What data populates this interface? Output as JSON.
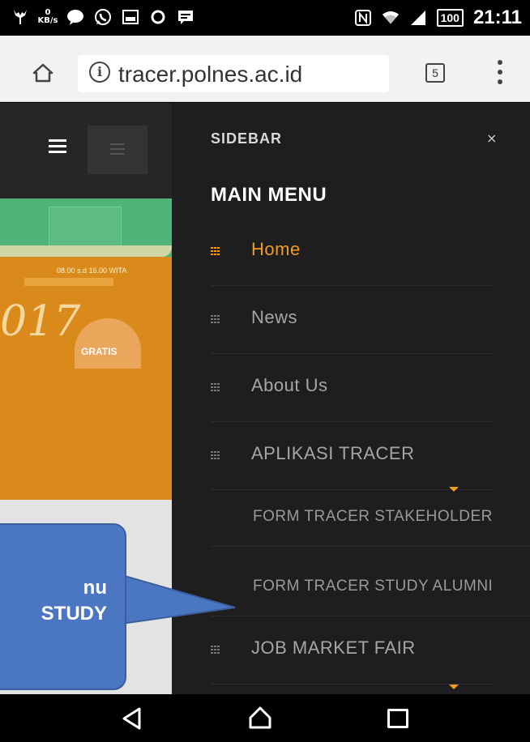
{
  "status_bar": {
    "speed_value": "0",
    "speed_unit": "KB/s",
    "battery": "100",
    "time": "21:11"
  },
  "browser": {
    "url": "tracer.polnes.ac.id",
    "tab_count": "5"
  },
  "banner": {
    "hours": "08.00 s.d 16.00 WITA",
    "year": "017",
    "gratis": "GRATIS"
  },
  "sidebar": {
    "title": "SIDEBAR",
    "close": "×",
    "main_menu": "MAIN MENU",
    "items": [
      {
        "label": "Home",
        "active": true
      },
      {
        "label": "News",
        "active": false
      },
      {
        "label": "About Us",
        "active": false
      },
      {
        "label": "APLIKASI TRACER",
        "active": false
      }
    ],
    "sub_items": [
      {
        "label": "FORM TRACER STAKEHOLDER"
      },
      {
        "label": "FORM TRACER STUDY ALUMNI"
      }
    ],
    "job_market": "JOB MARKET FAIR"
  },
  "callout": {
    "line1": "nu",
    "line2": "STUDY"
  },
  "colors": {
    "accent": "#f29c1f",
    "sidebar_bg": "#1e1e1e",
    "callout_bg": "#4b77c2"
  }
}
